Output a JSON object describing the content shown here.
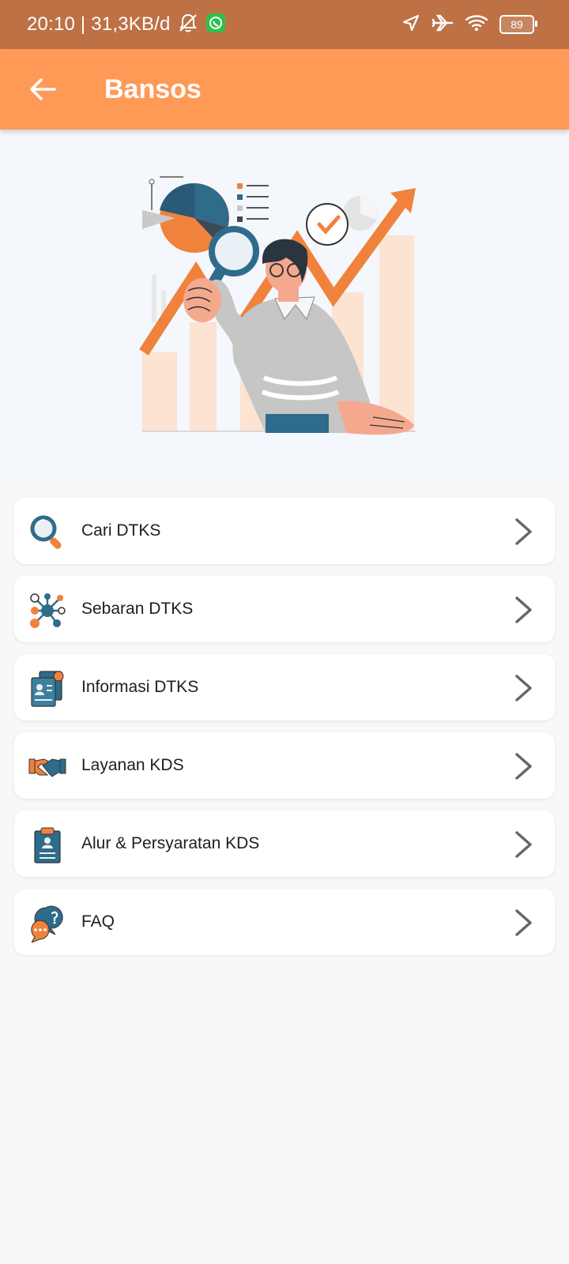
{
  "status_bar": {
    "time_network": "20:10 | 31,3KB/d",
    "battery": "89"
  },
  "app_bar": {
    "title": "Bansos"
  },
  "menu": {
    "items": [
      {
        "label": "Cari DTKS"
      },
      {
        "label": "Sebaran DTKS"
      },
      {
        "label": "Informasi DTKS"
      },
      {
        "label": "Layanan KDS"
      },
      {
        "label": "Alur & Persyaratan KDS"
      },
      {
        "label": "FAQ"
      }
    ]
  },
  "colors": {
    "status_bar": "#bd7145",
    "app_bar": "#ff9956",
    "accent_orange": "#f0823c",
    "accent_blue": "#2f6b8a"
  }
}
